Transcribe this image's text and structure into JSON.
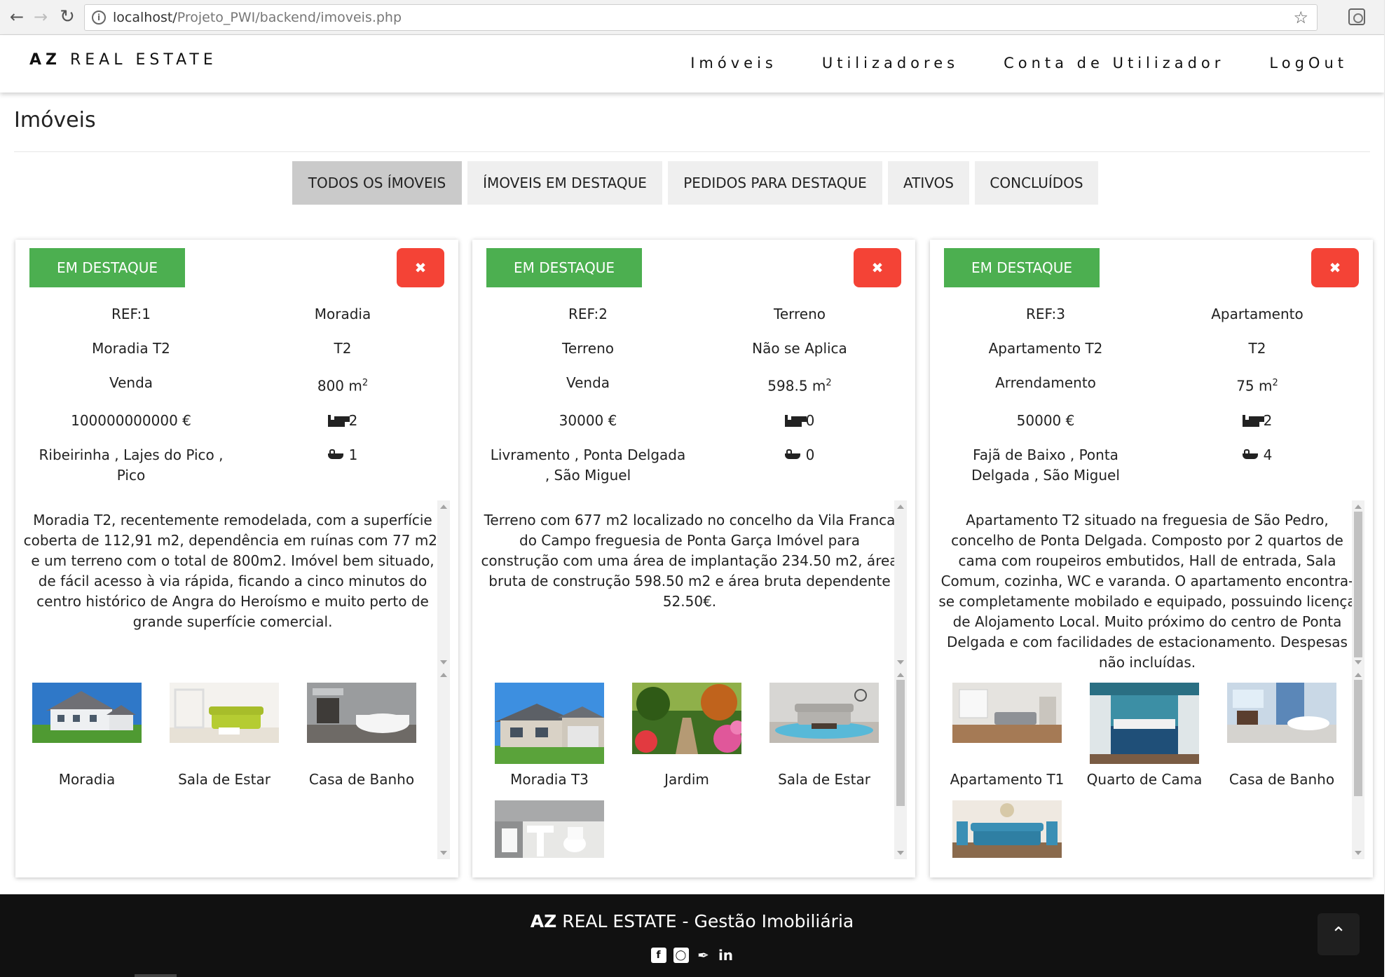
{
  "browser": {
    "url_host": "localhost/",
    "url_path": "Projeto_PWI/backend/imoveis.php"
  },
  "header": {
    "logo_bold": "AZ",
    "logo_rest": "REAL ESTATE",
    "nav": [
      "Imóveis",
      "Utilizadores",
      "Conta de Utilizador",
      "LogOut"
    ]
  },
  "page_title": "Imóveis",
  "tabs": [
    "TODOS OS ÍMOVEIS",
    "ÍMOVEIS EM DESTAQUE",
    "PEDIDOS PARA DESTAQUE",
    "ATIVOS",
    "CONCLUÍDOS"
  ],
  "active_tab": "TODOS OS ÍMOVEIS",
  "cards": [
    {
      "featured_label": "EM DESTAQUE",
      "delete_label": "✖",
      "ref": "REF:1",
      "type": "Moradia",
      "name": "Moradia T2",
      "typology": "T2",
      "deal": "Venda",
      "area": "800 m",
      "area_sup": "2",
      "price": "100000000000 €",
      "bedrooms": "2",
      "location": "Ribeirinha , Lajes do Pico , Pico",
      "bathrooms": "1",
      "description": "Moradia T2, recentemente remodelada, com a superfície coberta de 112,91 m2, dependência em ruínas com 77 m2, e um terreno com o total de 800m2. Imóvel bem situado, de fácil acesso à via rápida, ficando a cinco minutos do centro histórico de Angra do Heroísmo e muito perto de grande superfície comercial.",
      "photos": [
        "Moradia",
        "Sala de Estar",
        "Casa de Banho"
      ]
    },
    {
      "featured_label": "EM DESTAQUE",
      "delete_label": "✖",
      "ref": "REF:2",
      "type": "Terreno",
      "name": "Terreno",
      "typology": "Não se Aplica",
      "deal": "Venda",
      "area": "598.5 m",
      "area_sup": "2",
      "price": "30000 €",
      "bedrooms": "0",
      "location": "Livramento , Ponta Delgada , São Miguel",
      "bathrooms": "0",
      "description": "Terreno com 677 m2 localizado no concelho da Vila Franca do Campo freguesia de Ponta Garça Imóvel para construção com uma área de implantação 234.50 m2, área bruta de construção 598.50 m2 e área bruta dependente 52.50€.",
      "photos": [
        "Moradia T3",
        "Jardim",
        "Sala de Estar",
        ""
      ]
    },
    {
      "featured_label": "EM DESTAQUE",
      "delete_label": "✖",
      "ref": "REF:3",
      "type": "Apartamento",
      "name": "Apartamento T2",
      "typology": "T2",
      "deal": "Arrendamento",
      "area": "75 m",
      "area_sup": "2",
      "price": "50000 €",
      "bedrooms": "2",
      "location": "Fajã de Baixo , Ponta Delgada , São Miguel",
      "bathrooms": "4",
      "description": "Apartamento T2 situado na freguesia de São Pedro, concelho de Ponta Delgada. Composto por 2 quartos de cama com roupeiros embutidos, Hall de entrada, Sala Comum, cozinha, WC e varanda. O apartamento encontra-se completamente mobilado e equipado, possuindo licença de Alojamento Local. Muito próximo do centro de Ponta Delgada e com facilidades de estacionamento. Despesas não incluídas.",
      "photos": [
        "Apartamento T1",
        "Quarto de Cama",
        "Casa de Banho",
        ""
      ]
    }
  ],
  "footer": {
    "brand_bold": "AZ",
    "brand_rest": " REAL ESTATE - Gestão Imobiliária",
    "socials": [
      "facebook-icon",
      "instagram-icon",
      "twitter-icon",
      "linkedin-icon"
    ]
  },
  "colors": {
    "featured_green": "#4caf50",
    "delete_red": "#f44336",
    "active_tab": "#cacaca",
    "tab_bg": "#efefef",
    "footer_bg": "#111111"
  }
}
